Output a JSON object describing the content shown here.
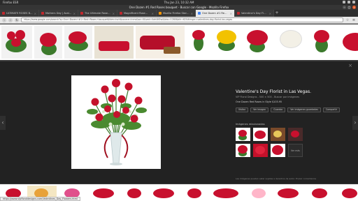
{
  "os": {
    "app_name": "Firefox ESR",
    "clock": "Thu Jan 23, 10:32 AM"
  },
  "window": {
    "title": "One Dozen #1 Red Roses bouquet - Buscar con Google - Mozilla Firefox"
  },
  "tabs": [
    {
      "label": "ULTIMATE ROSES BO...",
      "active": false,
      "favicon": "rose"
    },
    {
      "label": "Mothers Day | Avala...",
      "active": false,
      "favicon": "rose"
    },
    {
      "label": "The Ultimate Roses B...",
      "active": false,
      "favicon": "rose"
    },
    {
      "label": "Magnificent Rose® G...",
      "active": false,
      "favicon": "rose"
    },
    {
      "label": "Mozilla Firefox Start P...",
      "active": false,
      "favicon": "firefox"
    },
    {
      "label": "One Dozen #1 Red Ro...",
      "active": true,
      "favicon": "google"
    },
    {
      "label": "Valentine's Day Florist in ...",
      "active": false,
      "favicon": "rose"
    }
  ],
  "nav": {
    "url": "https://www.google.com/search?q=One+Dozen+#1+Red+Roses+bouquet&tbm=isch&source=lnms&sa=X&ved=0ahUKEwi&biw=1280&bih=620#imgrc=valentines-day-florist-las-vegas"
  },
  "viewer": {
    "title": "Valentine's Day Florist in Las Vegas.",
    "meta": "VIP Floral Designs - 500 × 500 - Buscar por imágenes",
    "description": "One Dozen Red Roses in Style $103.95",
    "buttons": [
      "Visitar",
      "Ver imagen",
      "Guardar",
      "Ver imágenes guardadas",
      "Compartir"
    ],
    "related_label": "Imágenes relacionadas",
    "more_label": "Ver más",
    "footer": "Las imágenes pueden estar sujetas a derechos de autor.   Enviar comentarios"
  },
  "status": {
    "text": "https://www.vipfloraldesigns.com/Valentines_Day_Flowers.html"
  }
}
